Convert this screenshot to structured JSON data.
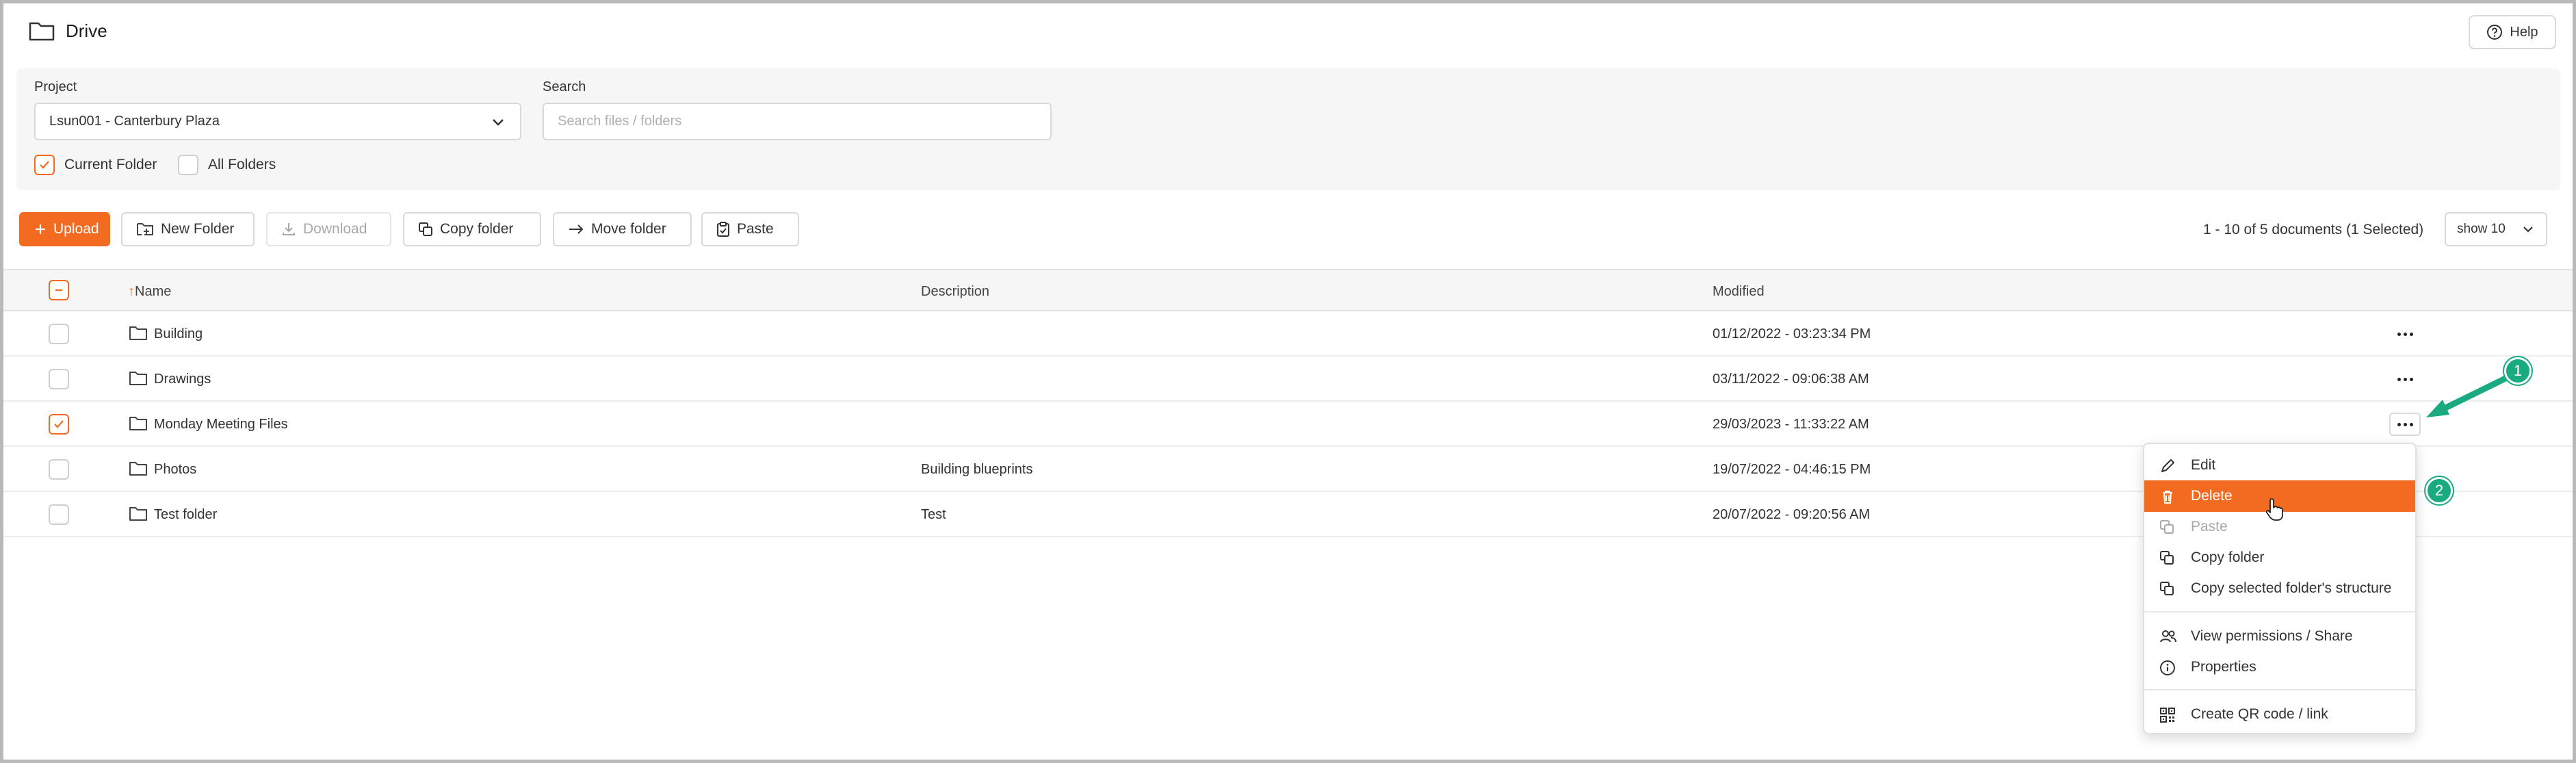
{
  "header": {
    "title": "Drive",
    "help_label": "Help"
  },
  "filters": {
    "project_label": "Project",
    "project_value": "Lsun001 - Canterbury Plaza",
    "search_label": "Search",
    "search_placeholder": "Search files / folders",
    "search_value": "",
    "current_folder_label": "Current Folder",
    "current_folder_checked": true,
    "all_folders_label": "All Folders",
    "all_folders_checked": false
  },
  "toolbar": {
    "upload_label": "Upload",
    "new_folder_label": "New Folder",
    "download_label": "Download",
    "copy_folder_label": "Copy folder",
    "move_folder_label": "Move folder",
    "paste_label": "Paste",
    "count_text": "1 - 10 of 5 documents (1 Selected)",
    "page_size": "show 10"
  },
  "table": {
    "columns": {
      "name": "Name",
      "description": "Description",
      "modified": "Modified"
    },
    "rows": [
      {
        "name": "Building",
        "description": "",
        "modified": "01/12/2022 - 03:23:34 PM",
        "selected": false
      },
      {
        "name": "Drawings",
        "description": "",
        "modified": "03/11/2022 - 09:06:38 AM",
        "selected": false
      },
      {
        "name": "Monday Meeting Files",
        "description": "",
        "modified": "29/03/2023 - 11:33:22 AM",
        "selected": true
      },
      {
        "name": "Photos",
        "description": "Building blueprints",
        "modified": "19/07/2022 - 04:46:15 PM",
        "selected": false
      },
      {
        "name": "Test folder",
        "description": "Test",
        "modified": "20/07/2022 - 09:20:56 AM",
        "selected": false
      }
    ]
  },
  "context_menu": {
    "items": [
      {
        "label": "Edit",
        "icon": "pencil-icon",
        "state": "normal"
      },
      {
        "label": "Delete",
        "icon": "trash-icon",
        "state": "highlighted"
      },
      {
        "label": "Paste",
        "icon": "copy-icon",
        "state": "disabled"
      },
      {
        "label": "Copy folder",
        "icon": "copy-icon",
        "state": "normal"
      },
      {
        "label": "Copy selected folder's structure",
        "icon": "copy-icon",
        "state": "normal"
      },
      {
        "label": "View permissions / Share",
        "icon": "users-icon",
        "state": "normal"
      },
      {
        "label": "Properties",
        "icon": "info-icon",
        "state": "normal"
      },
      {
        "label": "Create QR code / link",
        "icon": "qr-code-icon",
        "state": "normal"
      }
    ]
  },
  "annotations": {
    "step1": "1",
    "step2": "2"
  },
  "colors": {
    "accent": "#f26b21",
    "annotation": "#1aaa82",
    "border": "#d9d9d9",
    "panel_bg": "#f6f6f6"
  }
}
